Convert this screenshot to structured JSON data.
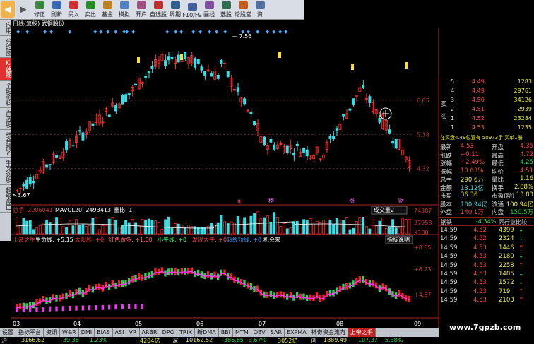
{
  "toolbar": {
    "buttons": [
      {
        "label": "修正",
        "icon": "edit-icon",
        "color": "#3a8a3a"
      },
      {
        "label": "刷新",
        "icon": "refresh-icon",
        "color": "#3a6ab0"
      },
      {
        "label": "买入",
        "icon": "buy-icon",
        "color": "#d03030"
      },
      {
        "label": "卖出",
        "icon": "sell-icon",
        "color": "#2a8a2a"
      },
      {
        "label": "基金",
        "icon": "fund-icon",
        "color": "#c08020"
      },
      {
        "label": "模拟",
        "icon": "simulate-icon",
        "color": "#5080c0"
      },
      {
        "label": "开户",
        "icon": "account-icon",
        "color": "#a05080"
      },
      {
        "label": "自选股",
        "icon": "watchlist-icon",
        "color": "#c03030"
      },
      {
        "label": "周期",
        "icon": "period-icon",
        "color": "#306090"
      },
      {
        "label": "F10/F9",
        "icon": "f10-icon",
        "color": "#4060a0"
      },
      {
        "label": "画线",
        "icon": "draw-icon",
        "color": "#8050a0"
      },
      {
        "label": "选股",
        "icon": "screen-icon",
        "color": "#307050"
      },
      {
        "label": "论股堂",
        "icon": "forum-icon",
        "color": "#c06020"
      },
      {
        "label": "资",
        "icon": "info-icon",
        "color": "#5070a0"
      }
    ]
  },
  "left_tabs": [
    {
      "label": "应用",
      "active": false
    },
    {
      "label": "分时图",
      "active": false
    },
    {
      "label": "K线图",
      "active": true
    },
    {
      "label": "个股资料",
      "active": false
    },
    {
      "label": "自选股",
      "active": false
    },
    {
      "label": "综合排名",
      "active": false
    },
    {
      "label": "牛叉诊股",
      "active": false
    },
    {
      "label": "超级盘口",
      "active": false
    }
  ],
  "chart": {
    "header": "日线(复权) 武钢股份",
    "price_high_label": "7.56",
    "price_low_label": "3.67",
    "y_ticks": [
      "6.05",
      "5.18",
      "4.32"
    ],
    "event_markers": [
      "q",
      "榜",
      "涨",
      "财"
    ],
    "volume_header": {
      "total": "总手: 2906041",
      "mavol": "MAVOL20: 2493413",
      "liang": "量比: 1"
    },
    "volume_selector": "成交量2",
    "volume_ticks": [
      "74387",
      "37953",
      "X100"
    ],
    "indicator_header": {
      "name": "上帝之手",
      "items": [
        "生命线: +5.15",
        "大阳线: +0",
        "红色做多: +1.00",
        "小牛线: +0",
        "发现大牛: +0",
        "超级短线: +0",
        "机会来"
      ]
    },
    "indicator_button": "指标说明",
    "indicator_ticks": [
      "+8.85",
      "+6.73",
      "+4.57"
    ],
    "x_labels": [
      "03",
      "04",
      "05",
      "06",
      "07",
      "08",
      "09"
    ]
  },
  "order_book": {
    "sell": [
      {
        "level": "5",
        "price": "4.49",
        "volume": "1283"
      },
      {
        "level": "4",
        "price": "4.49",
        "volume": "29761"
      },
      {
        "level": "3",
        "price": "4.50",
        "volume": "34126"
      },
      {
        "level": "2",
        "price": "4.51",
        "volume": "2939"
      },
      {
        "level": "1",
        "price": "4.52",
        "volume": "23284"
      },
      {
        "level": "1",
        "price": "4.53",
        "volume": "1235"
      }
    ],
    "sell_side_label": "卖",
    "buy_side_label": "买",
    "summary_line": "在买盘4.49位置有 50973手 买单1册"
  },
  "quote": {
    "rows": [
      {
        "l1": "最新",
        "v1": "4.53",
        "l2": "开盘",
        "v2": "4.35"
      },
      {
        "l1": "涨跌",
        "v1": "+0.11",
        "l2": "最高",
        "v2": "4.72"
      },
      {
        "l1": "涨幅",
        "v1": "+2.49%",
        "l2": "最低",
        "v2": "4.25"
      },
      {
        "l1": "振幅",
        "v1": "10.63%",
        "l2": "均价",
        "v2": "4.51"
      },
      {
        "l1": "总手",
        "v1": "290.6万",
        "l2": "量比",
        "v2": "1.16"
      },
      {
        "l1": "金额",
        "v1": "13.12亿",
        "l2": "换手",
        "v2": "2.88%"
      },
      {
        "l1": "市盈",
        "v1": "36.36",
        "l2": "市盈(动)",
        "v2": "13.83"
      },
      {
        "l1": "股本",
        "v1": "100.94亿",
        "l2": "流通",
        "v2": "100.94亿"
      },
      {
        "l1": "外盘",
        "v1": "140.1万",
        "l2": "内盘",
        "v2": "150.5万"
      }
    ],
    "sector_left": "钢铁",
    "sector_change": "-4.34%",
    "sector_right": "同行业比较"
  },
  "ticks": [
    {
      "time": "14:59",
      "price": "4.52",
      "vol": "4399",
      "dir": "down"
    },
    {
      "time": "14:59",
      "price": "4.52",
      "vol": "2324",
      "dir": "down"
    },
    {
      "time": "14:59",
      "price": "4.53",
      "vol": "1446",
      "dir": "up"
    },
    {
      "time": "14:59",
      "price": "4.53",
      "vol": "2180",
      "dir": "down"
    },
    {
      "time": "14:59",
      "price": "4.53",
      "vol": "2258",
      "dir": "up"
    },
    {
      "time": "14:59",
      "price": "4.53",
      "vol": "1485",
      "dir": "down"
    },
    {
      "time": "14:59",
      "price": "4.53",
      "vol": "1572",
      "dir": "down"
    },
    {
      "time": "14:59",
      "price": "4.53",
      "vol": "719",
      "dir": "up"
    },
    {
      "time": "14:59",
      "price": "4.53",
      "vol": "2103",
      "dir": "up"
    }
  ],
  "bottom_tabs": [
    {
      "label": "设置",
      "active": false
    },
    {
      "label": "指标平台",
      "active": false
    },
    {
      "label": "资讯",
      "active": false
    },
    {
      "label": "W&R",
      "active": false
    },
    {
      "label": "DMI",
      "active": false
    },
    {
      "label": "BIAS",
      "active": false
    },
    {
      "label": "ASI",
      "active": false
    },
    {
      "label": "VR",
      "active": false
    },
    {
      "label": "ARBR",
      "active": false
    },
    {
      "label": "DPO",
      "active": false
    },
    {
      "label": "TRIX",
      "active": false
    },
    {
      "label": "新DMA",
      "active": false
    },
    {
      "label": "BBI",
      "active": false
    },
    {
      "label": "MTM",
      "active": false
    },
    {
      "label": "OBV",
      "active": false
    },
    {
      "label": "SAR",
      "active": false
    },
    {
      "label": "EXPMA",
      "active": false
    },
    {
      "label": "神奇资金流向",
      "active": false
    },
    {
      "label": "上帝之手",
      "active": true
    }
  ],
  "status": {
    "items": [
      "沪",
      "3166.62",
      "-39.36",
      "-1.23%",
      "4204亿",
      "深",
      "10162.52",
      "-386.65",
      "-3.67%",
      "3052亿",
      "创",
      "1889.49",
      "-107.37",
      "-5.38%"
    ]
  },
  "watermark": "www.7gpzb.com",
  "colors": {
    "up": "#ff3333",
    "down": "#33e0e8",
    "life_line": "#ff33ff",
    "ma_line": "#ffffff",
    "axis": "#b02020"
  }
}
